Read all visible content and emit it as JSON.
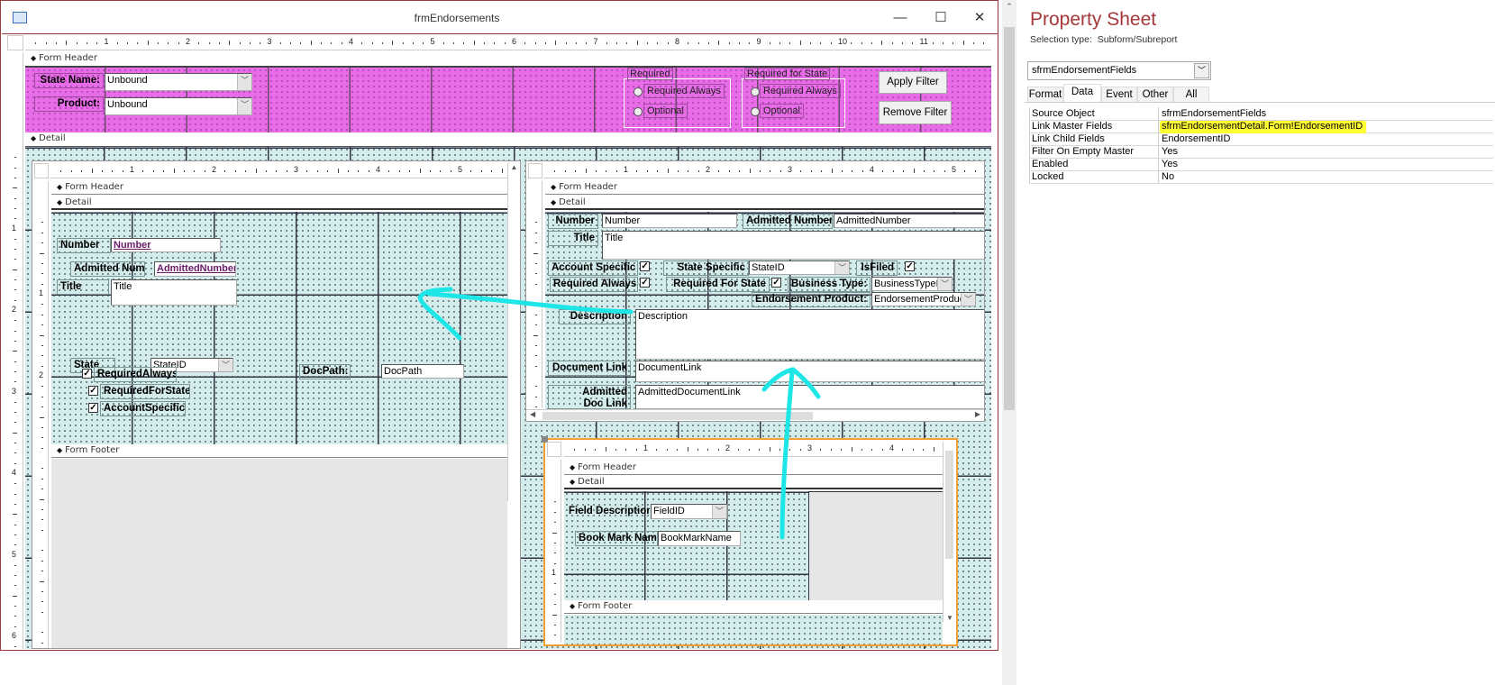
{
  "window": {
    "title": "frmEndorsements",
    "minimize": "—",
    "maximize": "☐",
    "close": "✕"
  },
  "main_ruler": {
    "numbers": [
      "1",
      "2",
      "3",
      "4",
      "5",
      "6",
      "7",
      "8",
      "9",
      "10",
      "11"
    ],
    "vnumbers": [
      "1",
      "2",
      "3",
      "4",
      "5",
      "6"
    ]
  },
  "sections": {
    "form_header": "Form Header",
    "detail": "Detail",
    "form_footer": "Form Footer"
  },
  "header_controls": {
    "state_name_label": "State Name:",
    "state_name_value": "Unbound",
    "product_label": "Product:",
    "product_value": "Unbound",
    "required_group": {
      "title": "Required",
      "options": [
        "Required Always",
        "Optional"
      ]
    },
    "required_state_group": {
      "title": "Required for State",
      "options": [
        "Required Always",
        "Optional"
      ]
    },
    "apply_filter": "Apply Filter",
    "remove_filter": "Remove Filter"
  },
  "left_subform": {
    "ruler": [
      "1",
      "2",
      "3",
      "4",
      "5"
    ],
    "vruler": [
      "1",
      "2"
    ],
    "number_label": "Number",
    "number_value": "Number",
    "admitted_label": "Admitted Numb",
    "admitted_value": "AdmittedNumber",
    "title_label": "Title",
    "title_value": "Title",
    "state_label": "State",
    "state_value": "StateID",
    "docpath_label": "DocPath:",
    "docpath_value": "DocPath",
    "checks": [
      "RequiredAlways",
      "RequiredForState",
      "AccountSpecific"
    ]
  },
  "right_subform": {
    "ruler": [
      "1",
      "2",
      "3",
      "4",
      "5"
    ],
    "number_label": "Number",
    "number_value": "Number",
    "admitted_label": "Admitted Number",
    "admitted_value": "AdmittedNumber",
    "title_label": "Title",
    "title_value": "Title",
    "account_specific_label": "Account Specific",
    "state_specific_label": "State Specific",
    "state_specific_value": "StateID",
    "isfiled_label": "IsFiled",
    "required_always_label": "Required Always",
    "required_for_state_label": "Required For State",
    "business_type_label": "Business Type:",
    "business_type_value": "BusinessTypeID",
    "endorsement_product_label": "Endorsement Product:",
    "endorsement_product_value": "EndorsementProductID",
    "description_label": "Description",
    "description_value": "Description",
    "document_link_label": "Document Link",
    "document_link_value": "DocumentLink",
    "admitted_doc_link_label": "Admitted Doc Link",
    "admitted_doc_link_value": "AdmittedDocumentLink"
  },
  "bottom_subform": {
    "ruler": [
      "1",
      "2",
      "3",
      "4"
    ],
    "vruler": [
      "1"
    ],
    "field_description_label": "Field Description:",
    "field_description_value": "FieldID",
    "bookmark_label": "Book Mark Name",
    "bookmark_value": "BookMarkName"
  },
  "property_sheet": {
    "title": "Property Sheet",
    "selection_type_label": "Selection type:",
    "selection_type": "Subform/Subreport",
    "selected_object": "sfrmEndorsementFields",
    "tabs": [
      "Format",
      "Data",
      "Event",
      "Other",
      "All"
    ],
    "active_tab": "Data",
    "properties": [
      {
        "name": "Source Object",
        "value": "sfrmEndorsementFields"
      },
      {
        "name": "Link Master Fields",
        "value": "sfrmEndorsementDetail.Form!EndorsementID"
      },
      {
        "name": "Link Child Fields",
        "value": "EndorsementID"
      },
      {
        "name": "Filter On Empty Master",
        "value": "Yes"
      },
      {
        "name": "Enabled",
        "value": "Yes"
      },
      {
        "name": "Locked",
        "value": "No"
      }
    ]
  },
  "colors": {
    "header_bg": "#e86be8",
    "detail_bg": "#d4ecec",
    "highlight": "#ffff33",
    "annotation": "#1ee6e6",
    "selection_border": "#f0a030",
    "property_title": "#a4373a"
  }
}
